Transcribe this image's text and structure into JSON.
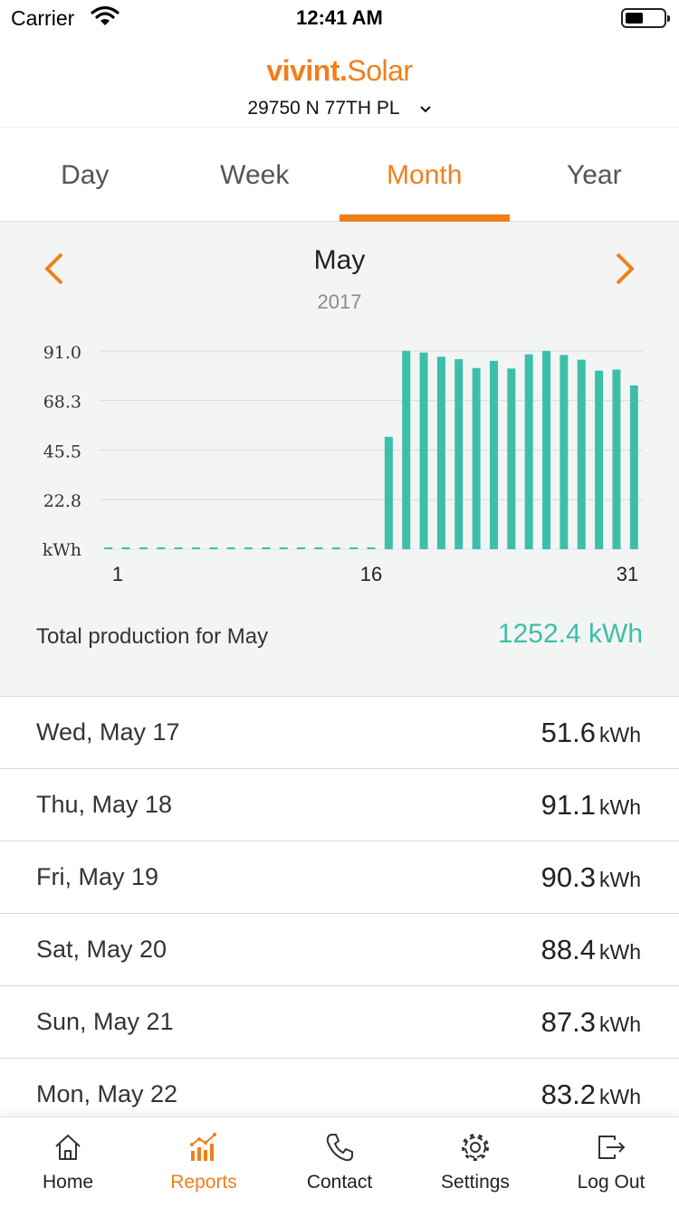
{
  "status_bar": {
    "carrier": "Carrier",
    "time": "12:41 AM",
    "battery_level": 0.45
  },
  "header": {
    "brand_part1": "vivint.",
    "brand_part2": "Solar",
    "site_address": "29750 N 77TH PL"
  },
  "tabs": [
    {
      "label": "Day",
      "active": false
    },
    {
      "label": "Week",
      "active": false
    },
    {
      "label": "Month",
      "active": true
    },
    {
      "label": "Year",
      "active": false
    }
  ],
  "period": {
    "month": "May",
    "year": "2017"
  },
  "chart_data": {
    "type": "bar",
    "x": [
      1,
      2,
      3,
      4,
      5,
      6,
      7,
      8,
      9,
      10,
      11,
      12,
      13,
      14,
      15,
      16,
      17,
      18,
      19,
      20,
      21,
      22,
      23,
      24,
      25,
      26,
      27,
      28,
      29,
      30,
      31
    ],
    "values": [
      0,
      0,
      0,
      0,
      0,
      0,
      0,
      0,
      0,
      0,
      0,
      0,
      0,
      0,
      0,
      0,
      51.6,
      91.1,
      90.3,
      88.4,
      87.3,
      83.2,
      86.5,
      83.0,
      89.5,
      91.0,
      89.2,
      87.0,
      82.0,
      82.5,
      75.2
    ],
    "yticks": [
      "91.0",
      "68.3",
      "45.5",
      "22.8"
    ],
    "ylabel": "kWh",
    "xticks": [
      "1",
      "16",
      "31"
    ],
    "ylim": [
      0,
      91
    ],
    "grid": true,
    "bar_color": "#3cbfa8"
  },
  "summary": {
    "label": "Total production for May",
    "value": "1252.4 kWh"
  },
  "daily_list": [
    {
      "date": "Wed, May 17",
      "value": "51.6",
      "unit": "kWh"
    },
    {
      "date": "Thu, May 18",
      "value": "91.1",
      "unit": "kWh"
    },
    {
      "date": "Fri, May 19",
      "value": "90.3",
      "unit": "kWh"
    },
    {
      "date": "Sat, May 20",
      "value": "88.4",
      "unit": "kWh"
    },
    {
      "date": "Sun, May 21",
      "value": "87.3",
      "unit": "kWh"
    },
    {
      "date": "Mon, May 22",
      "value": "83.2",
      "unit": "kWh"
    }
  ],
  "bottom_nav": [
    {
      "label": "Home",
      "icon": "home-icon",
      "active": false
    },
    {
      "label": "Reports",
      "icon": "reports-icon",
      "active": true
    },
    {
      "label": "Contact",
      "icon": "phone-icon",
      "active": false
    },
    {
      "label": "Settings",
      "icon": "gear-icon",
      "active": false
    },
    {
      "label": "Log Out",
      "icon": "logout-icon",
      "active": false
    }
  ],
  "colors": {
    "accent": "#f07f1b",
    "chart": "#3cbfa8",
    "panel": "#f3f5f4"
  }
}
